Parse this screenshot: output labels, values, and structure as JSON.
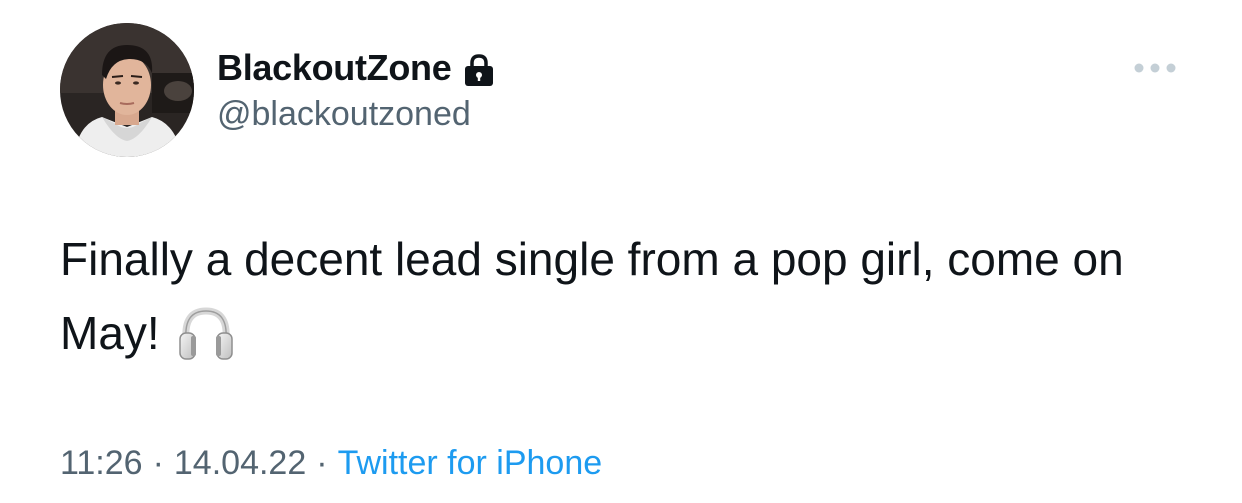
{
  "author": {
    "display_name": "BlackoutZone",
    "handle": "@blackoutzoned",
    "protected_icon": "lock-icon"
  },
  "tweet": {
    "text": "Finally a decent lead single from a pop girl, come on May! ",
    "emoji_icon": "headphones-icon"
  },
  "meta": {
    "time": "11:26",
    "separator": "·",
    "date": "14.04.22",
    "source": "Twitter for iPhone"
  },
  "actions": {
    "more_icon": "more-dots-icon"
  },
  "colors": {
    "text_primary": "#0f1419",
    "text_secondary": "#536471",
    "link": "#1d9bf0"
  }
}
